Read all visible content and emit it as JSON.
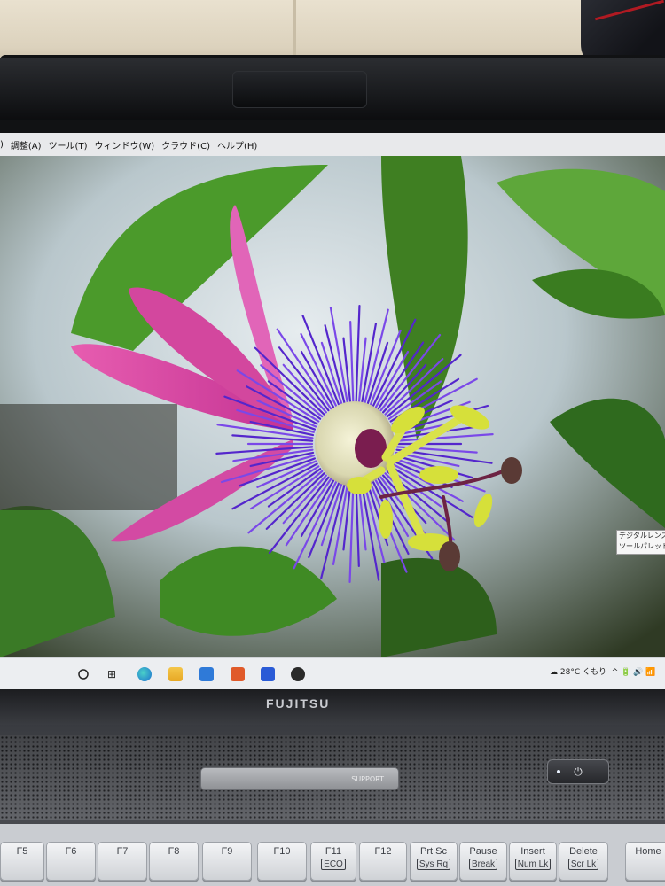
{
  "menu": {
    "items": [
      ")",
      "調整(A)",
      "ツール(T)",
      "ウィンドウ(W)",
      "クラウド(C)",
      "ヘルプ(H)"
    ]
  },
  "photo": {
    "subject": "passion flower",
    "colors": {
      "petal": "#d9459f",
      "corona": "#5b2fd6",
      "center": "#e8e6c8",
      "stamen": "#d7e13a",
      "leaf": "#3f8a24"
    }
  },
  "tooltip": {
    "line1": "デジタルレンズオ",
    "line2": "ツールパレットか"
  },
  "taskbar": {
    "icons": [
      "search-icon",
      "task-view-icon",
      "edge-icon",
      "file-explorer-icon",
      "mail-icon",
      "app-icon",
      "app-icon-2",
      "app-icon-3"
    ],
    "weather": "28°C くもり"
  },
  "laptop": {
    "brand": "FUJITSU",
    "support_label": "SUPPORT"
  },
  "keys": [
    {
      "top": "F5",
      "bottom": ""
    },
    {
      "top": "F6",
      "bottom": ""
    },
    {
      "top": "F7",
      "bottom": ""
    },
    {
      "top": "F8",
      "bottom": ""
    },
    {
      "top": "F9",
      "bottom": ""
    },
    {
      "top": "F10",
      "bottom": ""
    },
    {
      "top": "F11",
      "bottom": "ECO"
    },
    {
      "top": "F12",
      "bottom": ""
    },
    {
      "top": "Prt Sc",
      "bottom": "Sys Rq"
    },
    {
      "top": "Pause",
      "bottom": "Break"
    },
    {
      "top": "Insert",
      "bottom": "Num Lk"
    },
    {
      "top": "Delete",
      "bottom": "Scr Lk"
    },
    {
      "top": "Home",
      "bottom": ""
    }
  ]
}
